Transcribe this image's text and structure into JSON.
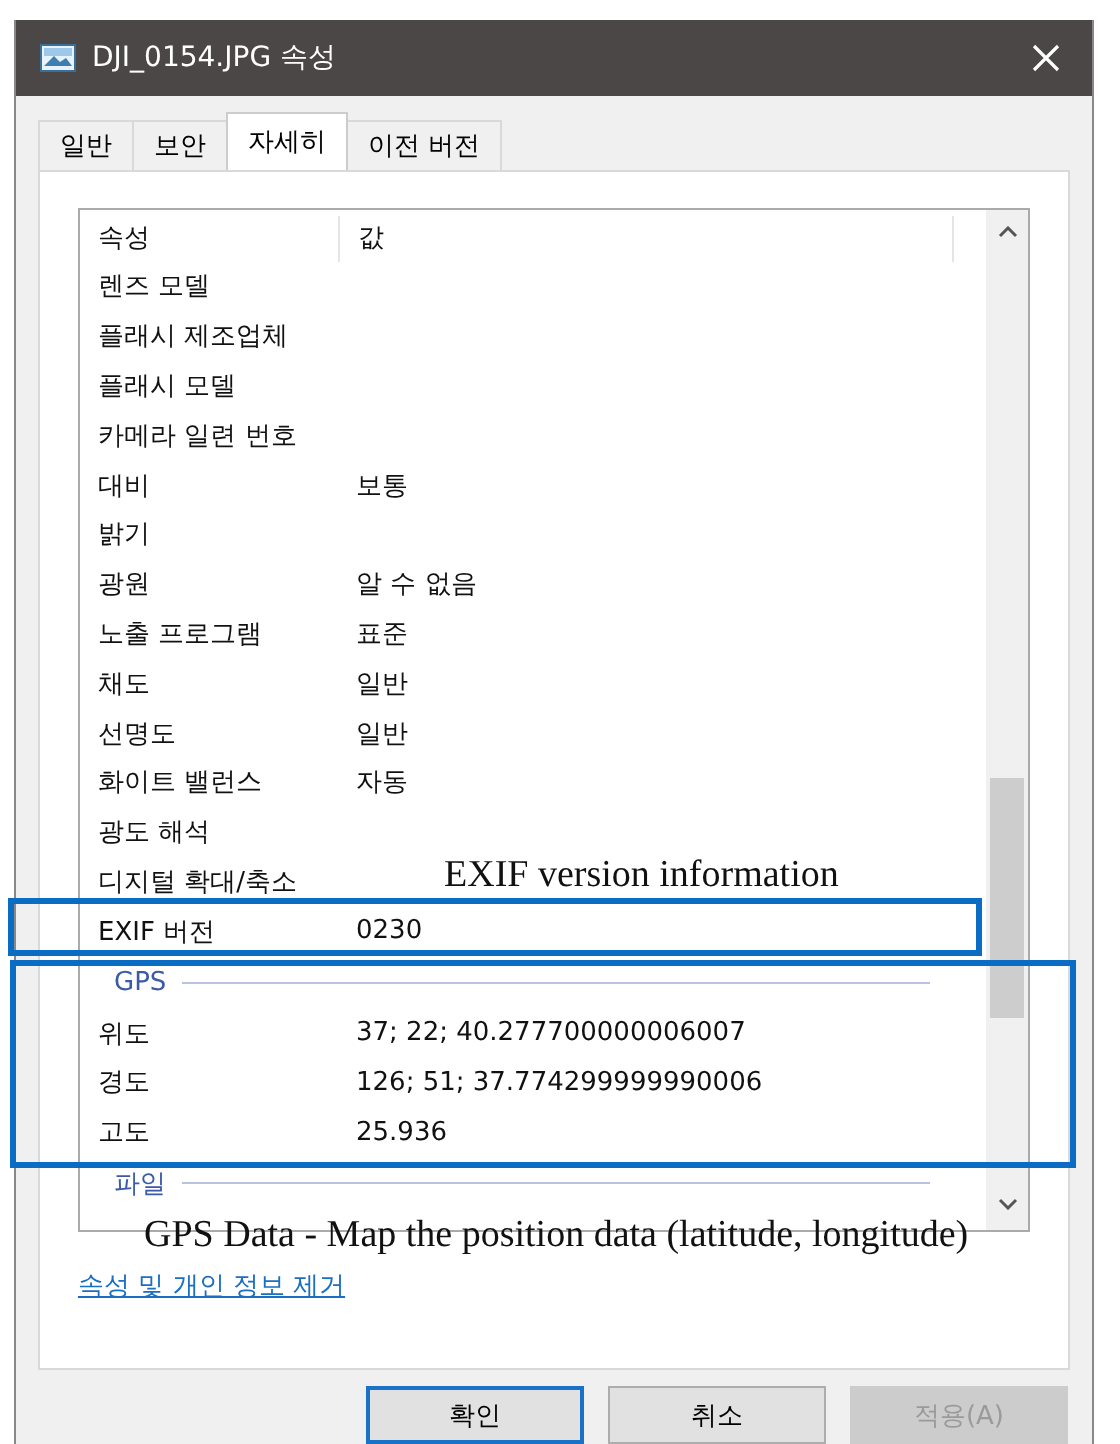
{
  "window": {
    "title": "DJI_0154.JPG 속성"
  },
  "tabs": [
    {
      "label": "일반",
      "selected": false
    },
    {
      "label": "보안",
      "selected": false
    },
    {
      "label": "자세히",
      "selected": true
    },
    {
      "label": "이전 버전",
      "selected": false
    }
  ],
  "list": {
    "columns": [
      "속성",
      "값"
    ],
    "rows": [
      {
        "kind": "row",
        "name": "렌즈 모델"
      },
      {
        "kind": "row",
        "name": "플래시 제조업체"
      },
      {
        "kind": "row",
        "name": "플래시 모델"
      },
      {
        "kind": "row",
        "name": "카메라 일련 번호"
      },
      {
        "kind": "row",
        "name": "대비",
        "value": "보통"
      },
      {
        "kind": "row",
        "name": "밝기"
      },
      {
        "kind": "row",
        "name": "광원",
        "value": "알 수 없음"
      },
      {
        "kind": "row",
        "name": "노출 프로그램",
        "value": "표준"
      },
      {
        "kind": "row",
        "name": "채도",
        "value": "일반"
      },
      {
        "kind": "row",
        "name": "선명도",
        "value": "일반"
      },
      {
        "kind": "row",
        "name": "화이트 밸런스",
        "value": "자동"
      },
      {
        "kind": "row",
        "name": "광도 해석"
      },
      {
        "kind": "row",
        "name": "디지털 확대/축소"
      },
      {
        "kind": "row",
        "name": "EXIF 버전",
        "value": "0230"
      },
      {
        "kind": "group",
        "name": "GPS"
      },
      {
        "kind": "row",
        "name": "위도",
        "value": "37; 22; 40.277700000006007"
      },
      {
        "kind": "row",
        "name": "경도",
        "value": "126; 51; 37.774299999990006"
      },
      {
        "kind": "row",
        "name": "고도",
        "value": "25.936"
      },
      {
        "kind": "group",
        "name": "파일"
      }
    ]
  },
  "link": "속성 및 개인 정보 제거",
  "buttons": [
    {
      "label": "확인",
      "default": true,
      "disabled": false
    },
    {
      "label": "취소",
      "default": false,
      "disabled": false
    },
    {
      "label": "적용(A)",
      "default": false,
      "disabled": true
    }
  ],
  "annotations": [
    {
      "kind": "exif",
      "text": "EXIF version information"
    },
    {
      "kind": "gps",
      "text": "GPS Data - Map the position data (latitude, longitude)"
    }
  ]
}
